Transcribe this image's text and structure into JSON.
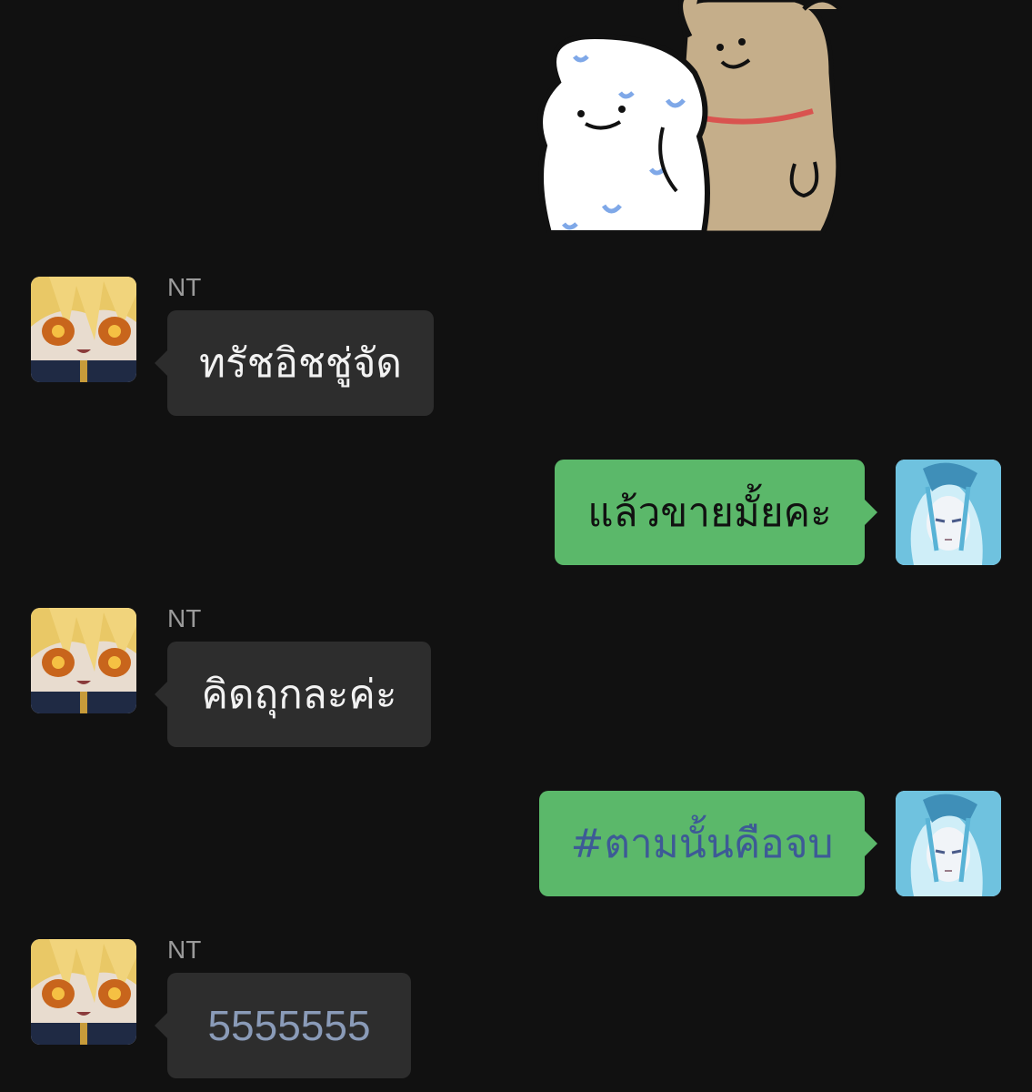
{
  "messages": [
    {
      "sender": "NT",
      "text": "ทรัชอิชชู่จัด"
    },
    {
      "text": "แล้วขายมั้ยคะ"
    },
    {
      "sender": "NT",
      "text": "คิดถุกละค่ะ"
    },
    {
      "text": "#ตามนั้นคือจบ"
    },
    {
      "sender": "NT",
      "text": "5555555"
    }
  ],
  "colors": {
    "background": "#111111",
    "incoming_bubble": "#2d2d2d",
    "outgoing_bubble": "#5bb86a",
    "hashtag": "#3d5a96",
    "number_link": "#8a9bb8"
  },
  "icons": {
    "sticker": "dogs-hugging-sticker",
    "nt_avatar": "blonde-anime-avatar",
    "self_avatar": "blue-hair-anime-avatar"
  }
}
